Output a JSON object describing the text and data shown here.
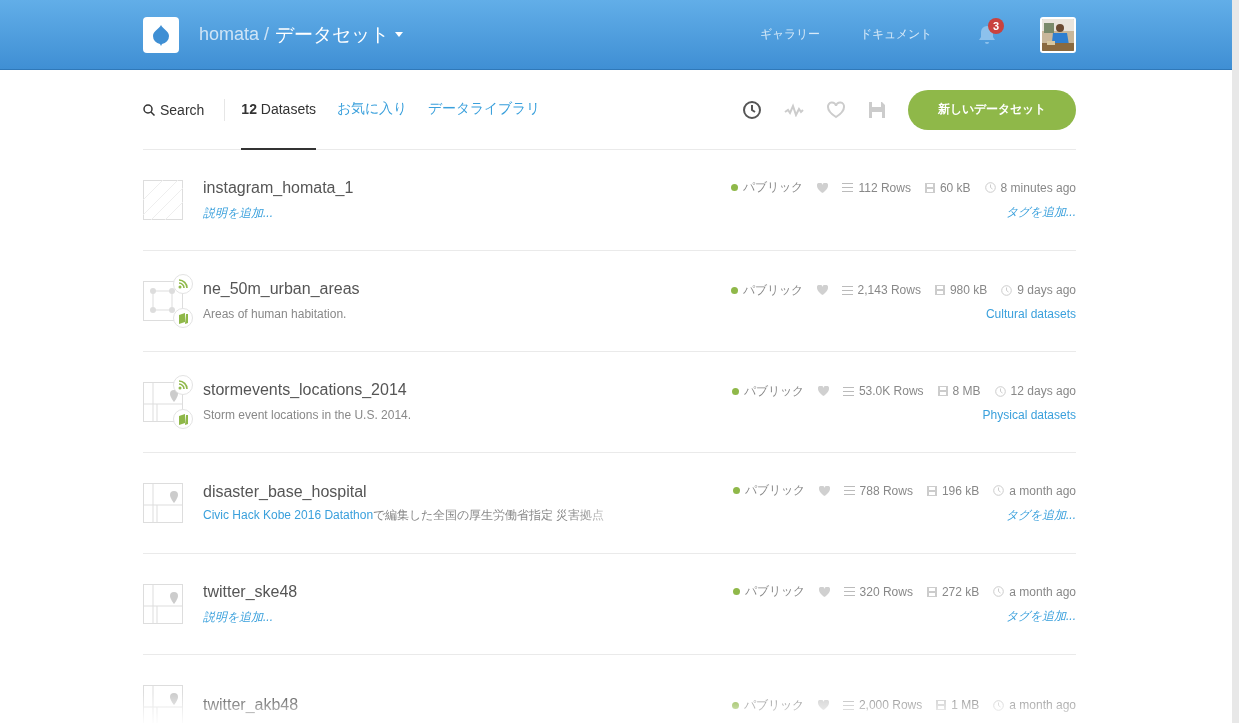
{
  "header": {
    "user": "homata /",
    "section": "データセット",
    "nav": [
      "ギャラリー",
      "ドキュメント"
    ],
    "notifications": "3"
  },
  "toolbar": {
    "search": "Search",
    "tabs": [
      {
        "label": "**12** Datasets",
        "selected": true
      },
      {
        "label": "お気に入り",
        "selected": false
      },
      {
        "label": "データライブラリ",
        "selected": false
      }
    ],
    "sort_icons": [
      {
        "kind": "clock",
        "selected": true
      },
      {
        "kind": "pulse",
        "selected": false
      },
      {
        "kind": "heart",
        "selected": false
      },
      {
        "kind": "disk",
        "selected": false
      }
    ],
    "new_button": "新しいデータセット"
  },
  "datasets": [
    {
      "name": "instagram_homata_1",
      "thumbnail": {
        "kind": "empty"
      },
      "badges": false,
      "description": {
        "kind": "add",
        "text": "説明を追加..."
      },
      "visibility": "パブリック",
      "liked": false,
      "rows": "112 Rows",
      "size": "60 kB",
      "updated": "8 minutes ago",
      "tag": {
        "kind": "add",
        "text": "タグを追加..."
      }
    },
    {
      "name": "ne_50m_urban_areas",
      "thumbnail": {
        "kind": "polygon"
      },
      "badges": true,
      "description": {
        "kind": "plain",
        "text": "Areas of human habitation."
      },
      "visibility": "パブリック",
      "liked": false,
      "rows": "2,143 Rows",
      "size": "980 kB",
      "updated": "9 days ago",
      "tag": {
        "kind": "link",
        "text": "Cultural datasets"
      }
    },
    {
      "name": "stormevents_locations_2014",
      "thumbnail": {
        "kind": "map"
      },
      "badges": true,
      "description": {
        "kind": "plain",
        "text": "Storm event locations in the U.S. 2014."
      },
      "visibility": "パブリック",
      "liked": false,
      "rows": "53.0K Rows",
      "size": "8 MB",
      "updated": "12 days ago",
      "tag": {
        "kind": "link",
        "text": "Physical datasets"
      }
    },
    {
      "name": "disaster_base_hospital",
      "thumbnail": {
        "kind": "map"
      },
      "badges": false,
      "description": {
        "kind": "linked",
        "link": "Civic Hack Kobe 2016 Datathon",
        "text": "で編集した全国の厚生労働省指定 災害拠点"
      },
      "visibility": "パブリック",
      "liked": false,
      "rows": "788 Rows",
      "size": "196 kB",
      "updated": "a month ago",
      "tag": {
        "kind": "add",
        "text": "タグを追加..."
      }
    },
    {
      "name": "twitter_ske48",
      "thumbnail": {
        "kind": "map"
      },
      "badges": false,
      "description": {
        "kind": "add",
        "text": "説明を追加..."
      },
      "visibility": "パブリック",
      "liked": false,
      "rows": "320 Rows",
      "size": "272 kB",
      "updated": "a month ago",
      "tag": {
        "kind": "add",
        "text": "タグを追加..."
      }
    },
    {
      "name": "twitter_akb48",
      "thumbnail": {
        "kind": "map"
      },
      "badges": false,
      "visibility": "パブリック",
      "liked": false,
      "rows": "2,000 Rows",
      "size": "1 MB",
      "updated": "a month ago"
    }
  ]
}
